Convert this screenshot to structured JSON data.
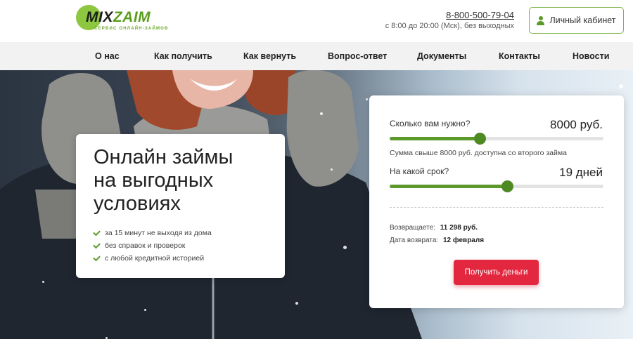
{
  "logo": {
    "mix": "MIX",
    "zaim": "ZAIM",
    "tagline": "СЕРВИС ОНЛАЙН-ЗАЙМОВ"
  },
  "header": {
    "phone": "8-800-500-79-04",
    "hours": "с 8:00 до 20:00 (Мск), без выходных",
    "cabinet_label": "Личный кабинет"
  },
  "nav": {
    "items": [
      "О нас",
      "Как получить",
      "Как вернуть",
      "Вопрос-ответ",
      "Документы",
      "Контакты",
      "Новости"
    ]
  },
  "promo": {
    "title_lines": [
      "Онлайн займы",
      "на выгодных",
      "условиях"
    ],
    "features": [
      "за 15 минут не выходя из дома",
      "без справок и проверок",
      "с любой кредитной историей"
    ]
  },
  "calculator": {
    "amount_label": "Сколько вам нужно?",
    "amount_value": "8000 руб.",
    "amount_fill": 0.42,
    "amount_note": "Сумма свыше 8000 руб. доступна со второго займа",
    "term_label": "На какой срок?",
    "term_value": "19 дней",
    "term_fill": 0.55,
    "repay_label": "Возвращаете:",
    "repay_value": "11 298 руб.",
    "date_label": "Дата возврата:",
    "date_value": "12 февраля",
    "button_label": "Получить деньги"
  },
  "colors": {
    "brand_green": "#5b9a2a",
    "accent_red": "#e2273f"
  }
}
